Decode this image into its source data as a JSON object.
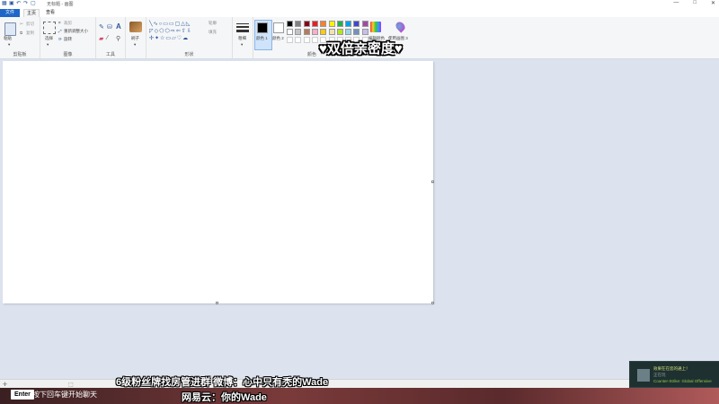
{
  "window": {
    "title": "无标题 - 画图",
    "quick_access_icons": [
      "save-icon",
      "undo-icon",
      "redo-icon",
      "new-icon"
    ],
    "controls": [
      "—",
      "□",
      "✕"
    ]
  },
  "ribbon": {
    "tabs": [
      "文件",
      "主页",
      "查看"
    ],
    "groups": {
      "clipboard": {
        "label": "剪贴板",
        "paste": "粘贴",
        "cut": "剪切",
        "copy": "复制"
      },
      "image": {
        "label": "图像",
        "select": "选择",
        "crop": "裁剪",
        "resize": "重新调整大小",
        "rotate": "旋转"
      },
      "tools": {
        "label": "工具"
      },
      "brushes": {
        "label": "刷子"
      },
      "shapes": {
        "label": "形状",
        "outline": "轮廓",
        "fill": "填充"
      },
      "size": {
        "label": "粗细"
      },
      "colors": {
        "label": "颜色",
        "color1": "颜色 1",
        "color2": "颜色 2",
        "edit_colors": "编辑颜色",
        "paint3d": "使用画图 3",
        "row1": [
          "#000000",
          "#7f7f7f",
          "#880015",
          "#ed1c24",
          "#ff7f27",
          "#fff200",
          "#22b14c",
          "#00a2e8",
          "#3f48cc",
          "#a349a4"
        ],
        "row2": [
          "#ffffff",
          "#c3c3c3",
          "#b97a57",
          "#ffaec9",
          "#ffc90e",
          "#efe4b0",
          "#b5e61d",
          "#99d9ea",
          "#7092be",
          "#c8bfe7"
        ]
      }
    }
  },
  "overlay": {
    "hearts_text": "♥双倍亲密度♥",
    "fan_line": "6级粉丝牌找房管进群  微博：心中只有秃的Wade",
    "netease_line": "网易云：你的Wade"
  },
  "gamebar": {
    "key": "Enter",
    "hint": "按下回车键开始聊天"
  },
  "notification": {
    "line1": "效果在在您的通上！",
    "line2": "正在玩",
    "line3": "Counter-Strike: Global Offensive"
  }
}
